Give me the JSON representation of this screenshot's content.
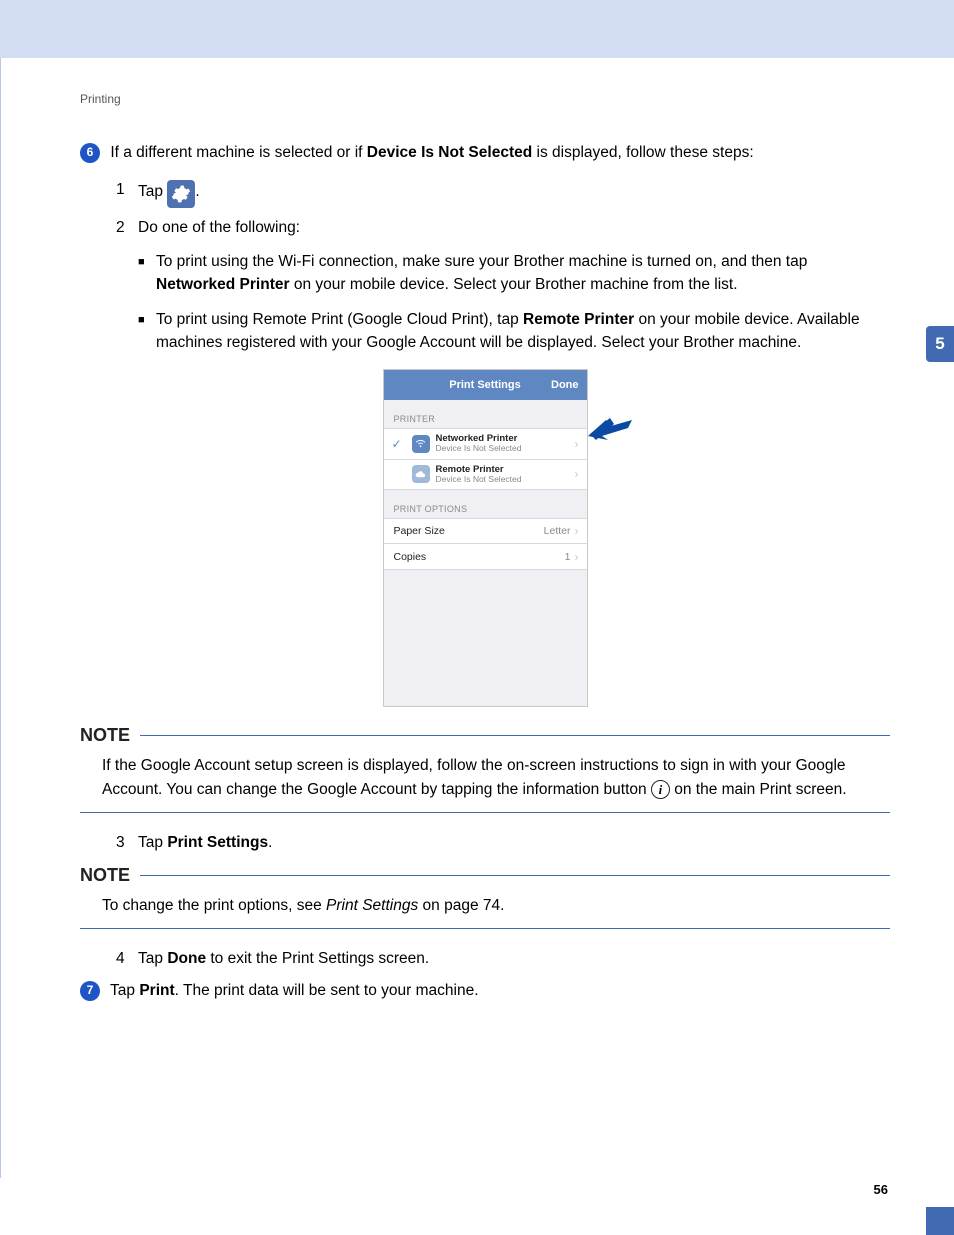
{
  "section": "Printing",
  "chapter_tab": "5",
  "page_number": "56",
  "steps": {
    "s6_num": "6",
    "s6_p1_a": "If a different machine is selected or if ",
    "s6_p1_b": "Device Is Not Selected",
    "s6_p1_c": " is displayed, follow these steps:",
    "s7_num": "7",
    "s7_a": "Tap ",
    "s7_b": "Print",
    "s7_c": ". The print data will be sent to your machine."
  },
  "sub": {
    "n1": "1",
    "n1_a": "Tap ",
    "n1_c": ".",
    "n2": "2",
    "n2_text": "Do one of the following:",
    "b1_a": "To print using the Wi-Fi connection, make sure your Brother machine is turned on, and then tap ",
    "b1_b": "Networked Printer",
    "b1_c": " on your mobile device. Select your Brother machine from the list.",
    "b2_a": "To print using Remote Print (Google Cloud Print), tap ",
    "b2_b": "Remote Printer",
    "b2_c": " on your mobile device. Available machines registered with your Google Account will be displayed. Select your Brother machine.",
    "n3": "3",
    "n3_a": "Tap ",
    "n3_b": "Print Settings",
    "n3_c": ".",
    "n4": "4",
    "n4_a": "Tap ",
    "n4_b": "Done",
    "n4_c": " to exit the Print Settings screen."
  },
  "notes": {
    "label": "NOTE",
    "note1_a": "If the Google Account setup screen is displayed, follow the on-screen instructions to sign in with your Google Account. You can change the Google Account by tapping the information button ",
    "note1_b": " on the main Print screen.",
    "note2_a": "To change the print options, see ",
    "note2_ref": "Print Settings",
    "note2_b": " on page 74."
  },
  "phone": {
    "title": "Print Settings",
    "done": "Done",
    "grp_printer": "PRINTER",
    "row1_t": "Networked Printer",
    "row1_s": "Device Is Not Selected",
    "row2_t": "Remote Printer",
    "row2_s": "Device Is Not Selected",
    "grp_options": "PRINT OPTIONS",
    "paper_label": "Paper Size",
    "paper_value": "Letter",
    "copies_label": "Copies",
    "copies_value": "1"
  }
}
